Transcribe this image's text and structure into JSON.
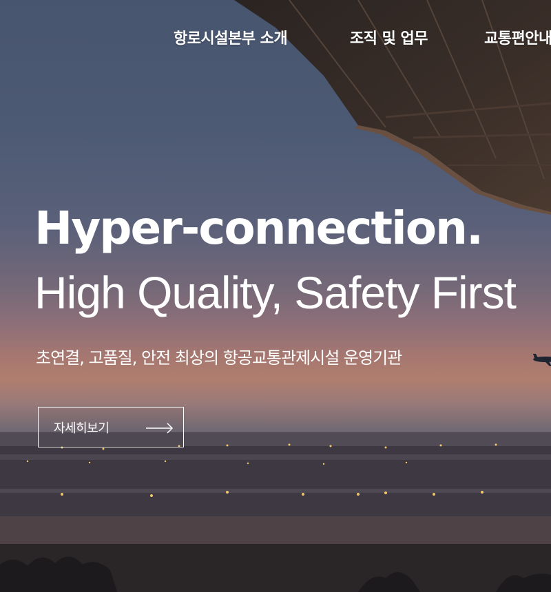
{
  "nav": {
    "items": [
      {
        "label": "항로시설본부 소개"
      },
      {
        "label": "조직 및 업무"
      },
      {
        "label": "교통편안내"
      }
    ]
  },
  "hero": {
    "headline": "Hyper-connection.",
    "subheadline": "High Quality, Safety First",
    "tagline": "초연결, 고품질, 안전 최상의 항공교통관제시설 운영기관",
    "cta_label": "자세히보기",
    "cta_icon": "arrow-right-icon"
  },
  "colors": {
    "text": "#ffffff",
    "sky_top": "#48556f",
    "horizon": "#b07e6e"
  }
}
